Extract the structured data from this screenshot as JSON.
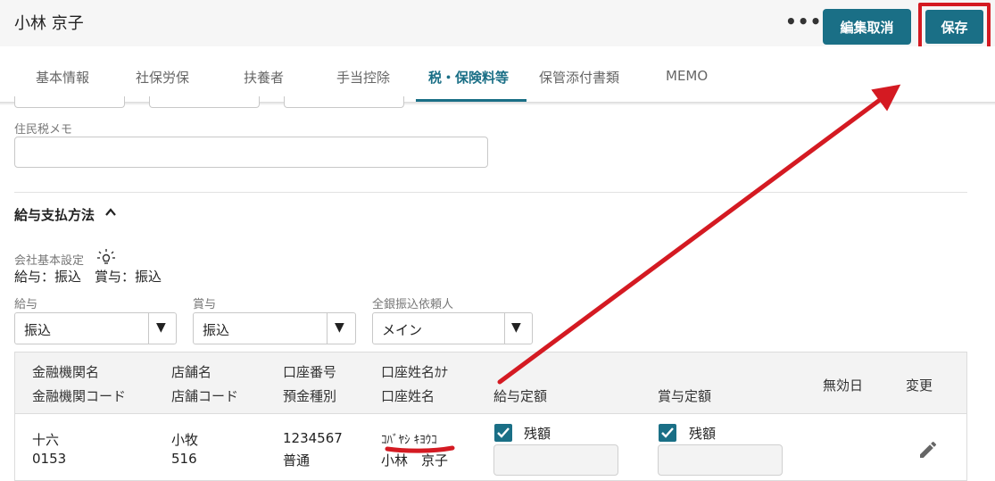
{
  "header": {
    "employee_name": "小林 京子",
    "more_label": "•••",
    "cancel_label": "編集取消",
    "save_label": "保存"
  },
  "tabs": [
    {
      "label": "基本情報"
    },
    {
      "label": "社保労保"
    },
    {
      "label": "扶養者"
    },
    {
      "label": "手当控除"
    },
    {
      "label": "税・保険料等"
    },
    {
      "label": "保管添付書類"
    },
    {
      "label": "MEMO"
    }
  ],
  "active_tab": "税・保険料等",
  "resident_tax_memo": {
    "label": "住民税メモ",
    "value": ""
  },
  "payment_method": {
    "title": "給与支払方法",
    "company_setting_label": "会社基本設定",
    "company_setting_value": "給与：振込　賞与：振込",
    "salary": {
      "label": "給与",
      "value": "振込"
    },
    "bonus": {
      "label": "賞与",
      "value": "振込"
    },
    "zengin": {
      "label": "全銀振込依頼人",
      "value": "メイン"
    },
    "dropdown_arrow": "▼"
  },
  "bank_table": {
    "headers": {
      "bank_name": "金融機関名",
      "bank_code": "金融機関コード",
      "branch_name": "店舗名",
      "branch_code": "店舗コード",
      "account_number": "口座番号",
      "account_type": "預金種別",
      "holder_kana": "口座姓名ｶﾅ",
      "holder_name": "口座姓名",
      "salary_fixed": "給与定額",
      "bonus_fixed": "賞与定額",
      "invalid_date": "無効日",
      "edit": "変更"
    },
    "rows": [
      {
        "bank_name": "十六",
        "bank_code": "0153",
        "branch_name": "小牧",
        "branch_code": "516",
        "account_number": "1234567",
        "account_type": "普通",
        "holder_kana": "ｺﾊﾞﾔｼ ｷﾖｳｺ",
        "holder_name": "小林　京子",
        "salary_remainder_checked": true,
        "salary_remainder_label": "残額",
        "salary_amount": "",
        "bonus_remainder_checked": true,
        "bonus_remainder_label": "残額",
        "bonus_amount": ""
      }
    ]
  },
  "colors": {
    "primary": "#1a6f86",
    "highlight": "#d41a22"
  },
  "icons": {
    "bulb": "lightbulb-icon",
    "chevron": "chevron-up-icon",
    "edit": "pencil-icon",
    "check": "check-icon"
  }
}
